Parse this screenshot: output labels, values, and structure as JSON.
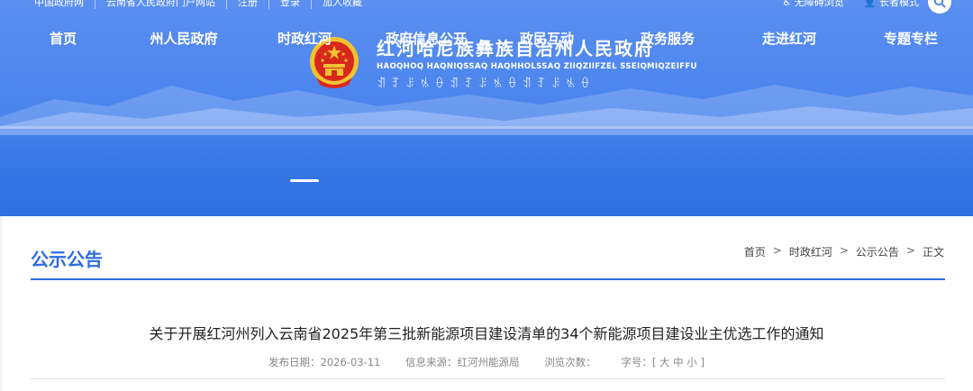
{
  "topbar": {
    "left_links": [
      "中国政府网",
      "云南省人民政府门户网站",
      "注册",
      "登录",
      "加入收藏"
    ],
    "right_links": [
      "无障碍浏览",
      "长者模式"
    ]
  },
  "header": {
    "title_cn": "红河哈尼族彝族自治州人民政府",
    "title_en": "HAOQHOQ HAQNIQSSAQ HAQHHOLSSAQ ZIIQZIIFZEL SSEIQMIQZEIFFU",
    "title_yi": "ꀊꆈꌠꁱꂷꀊꆈꌠꁱꂷꀊꆈꌠꁱꂷ"
  },
  "nav": {
    "items": [
      "首页",
      "州人民政府",
      "时政红河",
      "政府信息公开",
      "政民互动",
      "政务服务",
      "走进红河",
      "专题专栏"
    ],
    "active_index": 2
  },
  "section": {
    "title": "公示公告",
    "breadcrumb": [
      "首页",
      "时政红河",
      "公示公告",
      "正文"
    ],
    "breadcrumb_sep": ">"
  },
  "article": {
    "title": "关于开展红河州列入云南省2025年第三批新能源项目建设清单的34个新能源项目建设业主优选工作的通知",
    "publish_date": "发布日期：2026-03-11",
    "source": "信息来源：红河州能源局",
    "views": "浏览次数：",
    "font_size": "字号：[ 大 中 小 ]"
  },
  "colors": {
    "accent": "#2d6ce0",
    "header_bg": "#4d86ee",
    "emblem_red": "#d8271c",
    "emblem_gold": "#f2c230"
  }
}
